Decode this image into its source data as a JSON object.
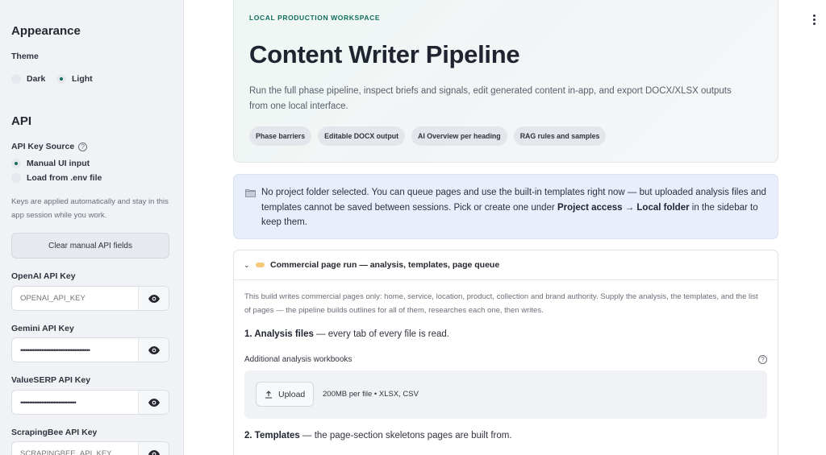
{
  "sidebar": {
    "appearance": {
      "heading": "Appearance",
      "theme_label": "Theme",
      "options": [
        {
          "label": "Dark",
          "selected": false
        },
        {
          "label": "Light",
          "selected": true
        }
      ]
    },
    "api": {
      "heading": "API",
      "source_label": "API Key Source",
      "source_help_icon": "help-circle-icon",
      "options": [
        {
          "label": "Manual UI input",
          "selected": true
        },
        {
          "label": "Load from .env file",
          "selected": false
        }
      ],
      "note": "Keys are applied automatically and stay in this app session while you work.",
      "clear_button": "Clear manual API fields",
      "keys": [
        {
          "label": "OpenAI API Key",
          "value": "",
          "placeholder": "OPENAI_API_KEY",
          "masked": false
        },
        {
          "label": "Gemini API Key",
          "value": "••••••••••••••••••••••••••••••••••••••••",
          "placeholder": "",
          "masked": true
        },
        {
          "label": "ValueSERP API Key",
          "value": "••••••••••••••••••••••••••••••••",
          "placeholder": "",
          "masked": true
        },
        {
          "label": "ScrapingBee API Key",
          "value": "",
          "placeholder": "SCRAPINGBEE_API_KEY",
          "masked": false
        }
      ]
    }
  },
  "header": {
    "eyebrow": "LOCAL PRODUCTION WORKSPACE",
    "title": "Content Writer Pipeline",
    "description": "Run the full phase pipeline, inspect briefs and signals, edit generated content in-app, and export DOCX/XLSX outputs from one local interface.",
    "chips": [
      "Phase barriers",
      "Editable DOCX output",
      "AI Overview per heading",
      "RAG rules and samples"
    ]
  },
  "alert": {
    "text_before": "No project folder selected. You can queue pages and use the built-in templates right now — but uploaded analysis files and templates cannot be saved between sessions. Pick or create one under ",
    "bold": "Project access → Local folder",
    "text_after": " in the sidebar to keep them."
  },
  "expander": {
    "title": "Commercial page run — analysis, templates, page queue",
    "description": "This build writes commercial pages only: home, service, location, product, collection and brand authority. Supply the analysis, the templates, and the list of pages — the pipeline builds outlines for all of them, researches each one, then writes.",
    "step1_bold": "1. Analysis files",
    "step1_rest": " — every tab of every file is read.",
    "workbooks_label": "Additional analysis workbooks",
    "upload_label": "Upload",
    "upload_limit": "200MB per file • XLSX, CSV",
    "step2_bold": "2. Templates",
    "step2_rest": " — the page-section skeletons pages are built from."
  },
  "colors": {
    "accent": "#0f6e5f",
    "sidebar_bg": "#f0f2f6",
    "alert_bg": "#e8effa"
  }
}
